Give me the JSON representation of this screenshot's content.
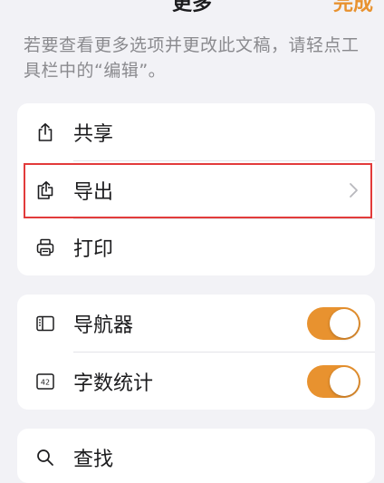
{
  "header": {
    "title": "更多",
    "done_label": "完成"
  },
  "hint": "若要查看更多选项并更改此文稿，请轻点工具栏中的“编辑”。",
  "group1": {
    "items": [
      {
        "label": "共享",
        "icon": "share-icon"
      },
      {
        "label": "导出",
        "icon": "export-icon"
      },
      {
        "label": "打印",
        "icon": "printer-icon"
      }
    ]
  },
  "group2": {
    "items": [
      {
        "label": "导航器",
        "icon": "navigator-icon",
        "toggle_on": true
      },
      {
        "label": "字数统计",
        "icon": "word-count-icon",
        "toggle_on": true,
        "icon_text": "42"
      }
    ]
  },
  "group3": {
    "items": [
      {
        "label": "查找",
        "icon": "search-icon"
      }
    ]
  },
  "colors": {
    "accent": "#e8922f",
    "highlight": "#e23b3b",
    "background": "#f2f2f6"
  }
}
